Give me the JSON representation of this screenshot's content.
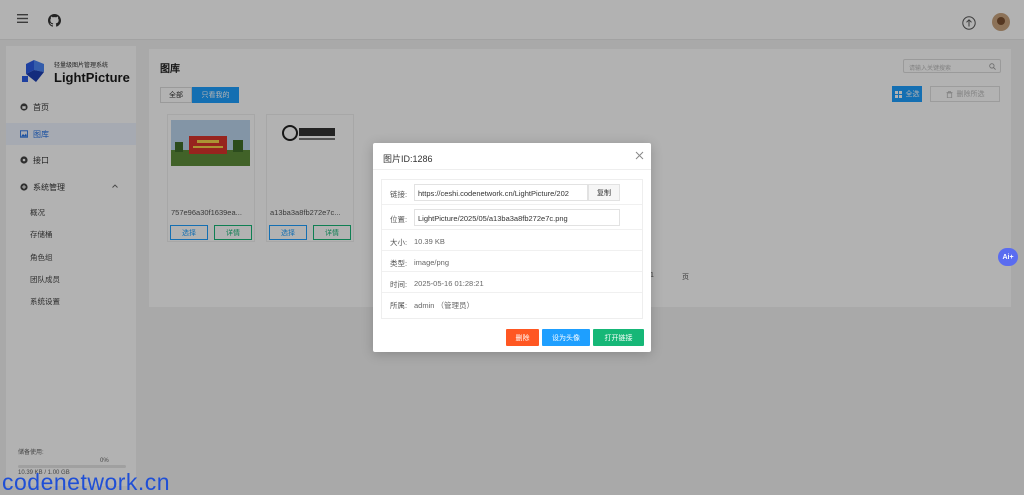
{
  "header": {
    "icons": [
      "menu-icon",
      "github-icon",
      "upload-icon",
      "avatar"
    ]
  },
  "sidebar": {
    "logo_subtitle": "轻量级图片管理系统",
    "logo_name": "LightPicture",
    "nav": [
      {
        "label": "首页",
        "icon": "home-icon"
      },
      {
        "label": "图库",
        "icon": "image-icon"
      },
      {
        "label": "接口",
        "icon": "api-icon"
      },
      {
        "label": "系统管理",
        "icon": "settings-icon"
      }
    ],
    "sub_items": [
      "概况",
      "存储桶",
      "角色组",
      "团队成员",
      "系统设置"
    ],
    "storage": {
      "label": "储备使用:",
      "percent": "0%",
      "value": "10.39 KB / 1.00 GB",
      "usage_fraction": 0
    }
  },
  "main": {
    "title": "图库",
    "search_placeholder": "请输入关键搜索",
    "tabs": [
      "全部",
      "只看我的"
    ],
    "select_all": "全选",
    "delete_selected": "删除所选",
    "cards": [
      {
        "name": "757e96a30f1639ea...",
        "select": "选择",
        "detail": "详情"
      },
      {
        "name": "a13ba3a8fb272e7c...",
        "select": "选择",
        "detail": "详情"
      }
    ],
    "pager": {
      "page": "1",
      "suffix": "页"
    }
  },
  "dialog": {
    "title": "图片ID:1286",
    "rows": {
      "link_label": "链接:",
      "link_value": "https://ceshi.codenetwork.cn/LightPicture/202",
      "copy_label": "复制",
      "location_label": "位置:",
      "location_value": "LightPicture/2025/05/a13ba3a8fb272e7c.png",
      "size_label": "大小:",
      "size_value": "10.39 KB",
      "type_label": "类型:",
      "type_value": "image/png",
      "time_label": "时间:",
      "time_value": "2025-05-16 01:28:21",
      "owner_label": "所属:",
      "owner_value": "admin （管理员）"
    },
    "buttons": {
      "delete": "删除",
      "set_avatar": "设为头像",
      "open_link": "打开链接"
    }
  },
  "ai_badge": "Ai+",
  "watermark": "codenetwork.cn",
  "colors": {
    "primary": "#1e9fff",
    "danger": "#ff5722",
    "success": "#16b777",
    "ai": "#5a6cf0",
    "watermark": "#1f4fd6"
  }
}
